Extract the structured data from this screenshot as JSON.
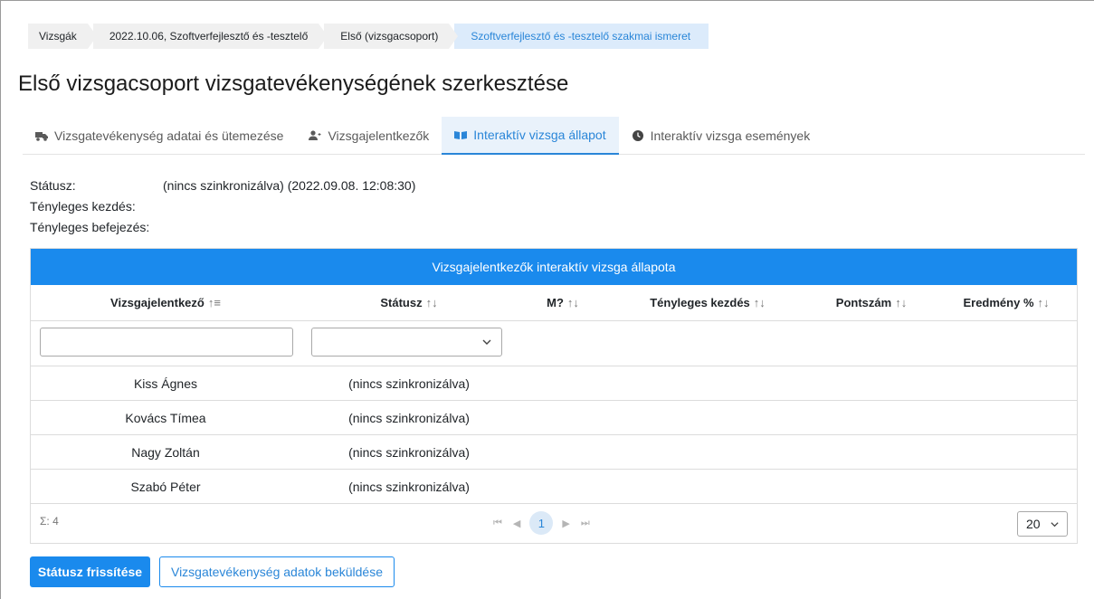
{
  "breadcrumb": [
    {
      "label": "Vizsgák"
    },
    {
      "label": "2022.10.06, Szoftverfejlesztő és -tesztelő"
    },
    {
      "label": "Első (vizsgacsoport)"
    },
    {
      "label": "Szoftverfejlesztő és -tesztelő szakmai ismeret"
    }
  ],
  "page_title": "Első vizsgacsoport vizsgatevékenységének szerkesztése",
  "tabs": [
    {
      "label": "Vizsgatevékenység adatai és ütemezése",
      "icon": "truck-icon"
    },
    {
      "label": "Vizsgajelentkezők",
      "icon": "user-plus-icon"
    },
    {
      "label": "Interaktív vizsga állapot",
      "icon": "book-open-icon",
      "active": true
    },
    {
      "label": "Interaktív vizsga események",
      "icon": "clock-icon"
    }
  ],
  "status": {
    "status_label": "Státusz:",
    "status_value": "(nincs szinkronizálva) (2022.09.08. 12:08:30)",
    "start_label": "Tényleges kezdés:",
    "start_value": "",
    "end_label": "Tényleges befejezés:",
    "end_value": ""
  },
  "grid": {
    "caption": "Vizsgajelentkezők interaktív vizsga állapota",
    "columns": [
      "Vizsgajelentkező",
      "Státusz",
      "M?",
      "Tényleges kezdés",
      "Pontszám",
      "Eredmény %"
    ],
    "sort_icons": [
      "↑≡",
      "↑↓",
      "↑↓",
      "↑↓",
      "↑↓",
      "↑↓"
    ],
    "filter_input_value": "",
    "filter_select_value": "",
    "rows": [
      {
        "name": "Kiss Ágnes",
        "status": "(nincs szinkronizálva)"
      },
      {
        "name": "Kovács Tímea",
        "status": "(nincs szinkronizálva)"
      },
      {
        "name": "Nagy Zoltán",
        "status": "(nincs szinkronizálva)"
      },
      {
        "name": "Szabó Péter",
        "status": "(nincs szinkronizálva)"
      }
    ],
    "total": "Σ: 4",
    "pager": {
      "first": "⏮",
      "prev": "◀",
      "current": "1",
      "next": "▶",
      "last": "⏭"
    },
    "page_size": "20"
  },
  "buttons": {
    "refresh": "Státusz frissítése",
    "submit": "Vizsgatevékenység adatok beküldése"
  },
  "colors": {
    "accent": "#1a8aed",
    "active_tab_bg": "#e9f2fb"
  }
}
